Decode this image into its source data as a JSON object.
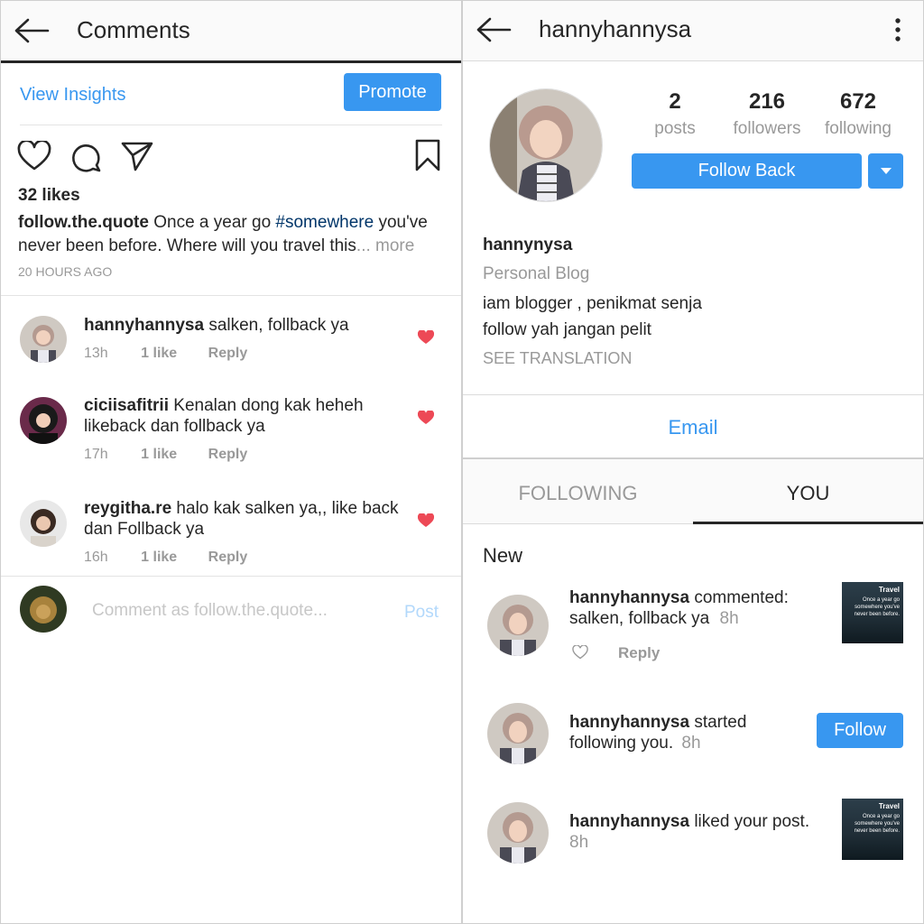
{
  "left": {
    "title": "Comments",
    "view_insights": "View Insights",
    "promote": "Promote",
    "likes": "32 likes",
    "caption_user": "follow.the.quote",
    "caption_pre": " Once a year go ",
    "caption_tag": "#somewhere",
    "caption_post": " you've never been before. Where will you travel this",
    "caption_more": "... more",
    "timestamp": "20 HOURS AGO",
    "comments": [
      {
        "user": "hannyhannysa",
        "text": " salken, follback ya",
        "time": "13h",
        "likes": "1 like",
        "reply": "Reply"
      },
      {
        "user": "ciciisafitrii",
        "text": " Kenalan dong kak heheh likeback dan follback ya",
        "time": "17h",
        "likes": "1 like",
        "reply": "Reply"
      },
      {
        "user": "reygitha.re",
        "text": " halo kak salken ya,, like back dan Follback ya",
        "time": "16h",
        "likes": "1 like",
        "reply": "Reply"
      }
    ],
    "comment_placeholder": "Comment as follow.the.quote...",
    "post": "Post"
  },
  "right": {
    "title": "hannyhannysa",
    "stats": [
      {
        "value": "2",
        "label": "posts"
      },
      {
        "value": "216",
        "label": "followers"
      },
      {
        "value": "672",
        "label": "following"
      }
    ],
    "follow_back": "Follow Back",
    "name": "hannynysa",
    "category": "Personal Blog",
    "bio_line1": "iam blogger , penikmat senja",
    "bio_line2": "follow yah jangan pelit",
    "see_translation": "SEE TRANSLATION",
    "email": "Email",
    "tab_following": "FOLLOWING",
    "tab_you": "YOU",
    "section_new": "New",
    "notifications": [
      {
        "user": "hannyhannysa",
        "text": " commented: salken, follback ya",
        "time": "8h",
        "reply": "Reply"
      },
      {
        "user": "hannyhannysa",
        "text": " started following you.",
        "time": "8h",
        "button": "Follow"
      },
      {
        "user": "hannyhannysa",
        "text": " liked your post.",
        "time": "8h"
      }
    ],
    "thumb_title": "Travel",
    "thumb_caption": "Once a year go somewhere you've never been before."
  },
  "colors": {
    "accent": "#3897f0",
    "heart": "#ed4956",
    "hashtag": "#003569"
  }
}
